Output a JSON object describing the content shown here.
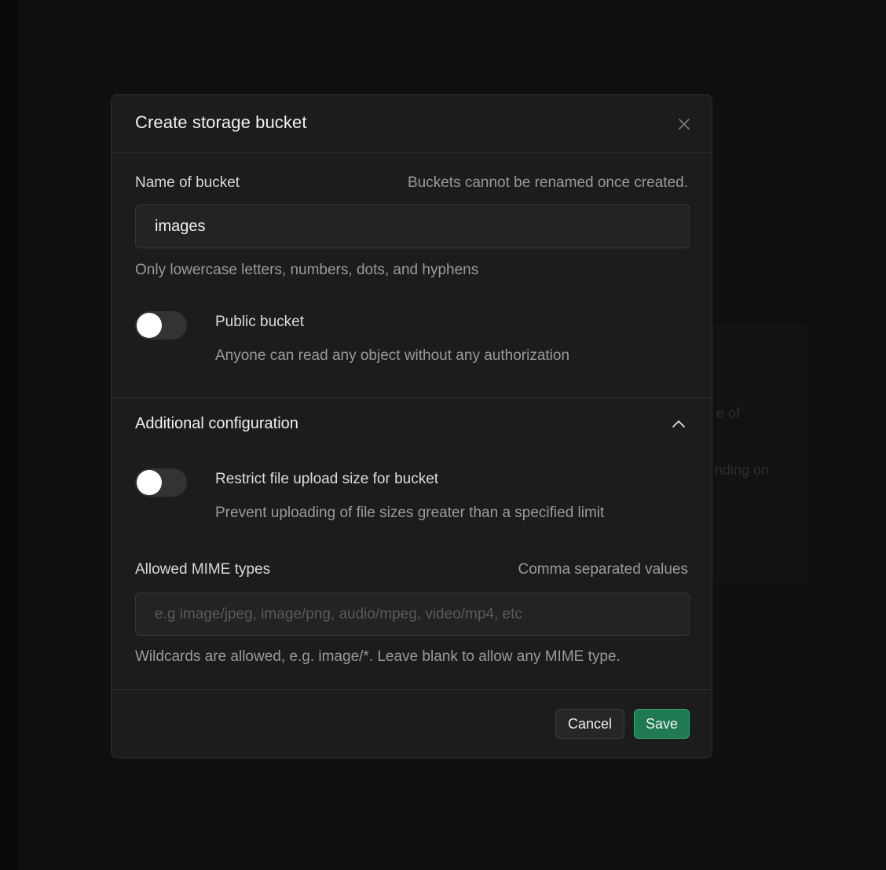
{
  "modal": {
    "title": "Create storage bucket"
  },
  "name_field": {
    "label": "Name of bucket",
    "hint": "Buckets cannot be renamed once created.",
    "value": "images",
    "help": "Only lowercase letters, numbers, dots, and hyphens"
  },
  "public_toggle": {
    "title": "Public bucket",
    "description": "Anyone can read any object without any authorization",
    "enabled": false
  },
  "additional_config": {
    "title": "Additional configuration",
    "expanded": true,
    "restrict_toggle": {
      "title": "Restrict file upload size for bucket",
      "description": "Prevent uploading of file sizes greater than a specified limit",
      "enabled": false
    },
    "mime_field": {
      "label": "Allowed MIME types",
      "hint": "Comma separated values",
      "value": "",
      "placeholder": "e.g image/jpeg, image/png, audio/mpeg, video/mp4, etc",
      "help": "Wildcards are allowed, e.g. image/*. Leave blank to allow any MIME type."
    }
  },
  "footer": {
    "cancel_label": "Cancel",
    "save_label": "Save"
  },
  "background": {
    "fragment1": "e of",
    "fragment2": "nding on"
  },
  "icons": {
    "close": "close-icon",
    "chevron": "chevron-up-icon"
  },
  "colors": {
    "accent": "#1f7a52",
    "modal_bg": "#1c1c1c",
    "border": "#2e2e2e"
  }
}
